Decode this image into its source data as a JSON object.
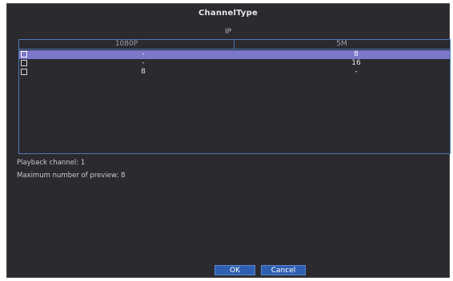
{
  "dialog": {
    "title": "ChannelType",
    "section": "IP"
  },
  "table": {
    "columns": [
      "1080P",
      "5M"
    ],
    "rows": [
      {
        "checked": true,
        "selected": true,
        "col1": "-",
        "col2": "8"
      },
      {
        "checked": false,
        "selected": false,
        "col1": "-",
        "col2": "16"
      },
      {
        "checked": false,
        "selected": false,
        "col1": "8",
        "col2": "-"
      }
    ]
  },
  "info": {
    "playback": "Playback channel: 1",
    "preview": "Maximum number of preview: 8"
  },
  "buttons": {
    "ok": "OK",
    "cancel": "Cancel"
  },
  "colors": {
    "background": "#2b2a2f",
    "table_border": "#4c79b6",
    "selected_row": "#7b77c9",
    "button": "#2f5fb0"
  }
}
